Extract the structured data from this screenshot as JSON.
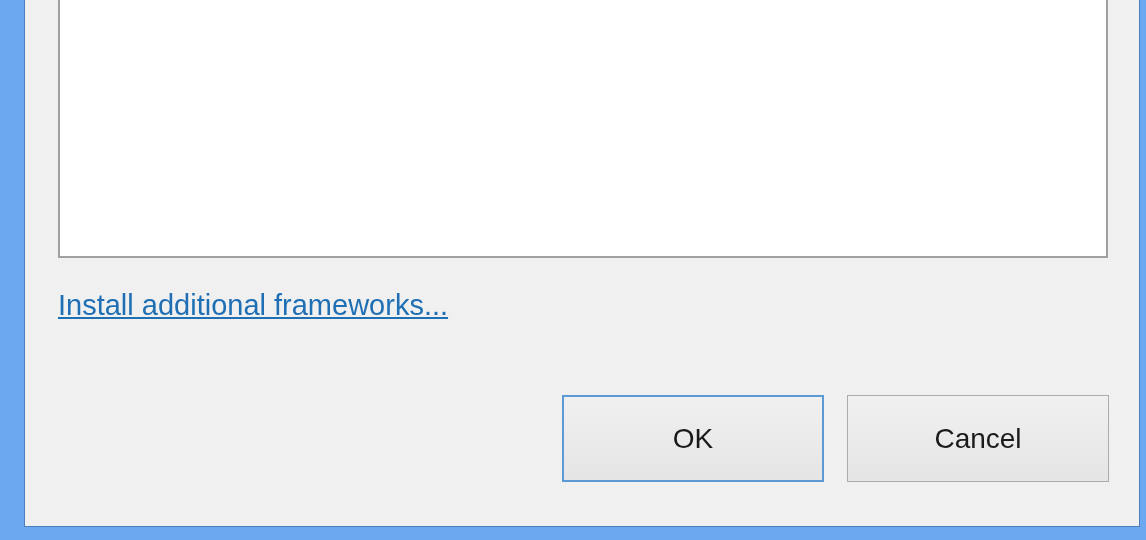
{
  "list_box": {
    "kind": "empty"
  },
  "link": "Install additional frameworks...",
  "buttons": [
    {
      "label": "OK",
      "default": true
    },
    {
      "label": "Cancel",
      "default": false
    }
  ]
}
